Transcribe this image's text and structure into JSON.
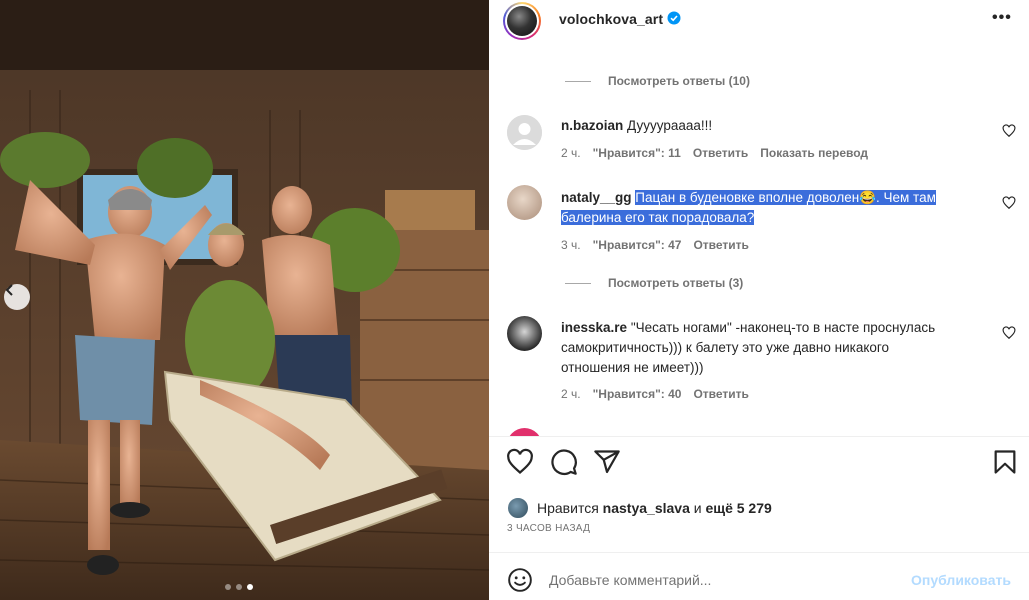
{
  "post": {
    "username": "volochkova_art",
    "carousel_dots": 3,
    "carousel_active": 3
  },
  "comments": {
    "replies_1": "Посмотреть ответы (10)",
    "c1": {
      "user": "n.bazoian",
      "text": "Дуууураааа!!!",
      "time": "2 ч.",
      "likes": "\"Нравится\": 11",
      "reply": "Ответить",
      "translate": "Показать перевод"
    },
    "c2": {
      "user": "nataly__gg",
      "text_line1": "Пацан в буденовке вполне доволен😂. Чем там",
      "text_line2": "балерина его так порадовала?",
      "time": "3 ч.",
      "likes": "\"Нравится\": 47",
      "reply": "Ответить"
    },
    "replies_2": "Посмотреть ответы (3)",
    "c3": {
      "user": "inesska.re",
      "text_line1": "\"Чесать ногами\" -наконец-то в насте проснулась",
      "text_line2": "самокритичность))) к балету это уже давно никакого",
      "text_line3": "отношения не имеет)))",
      "time": "2 ч.",
      "likes": "\"Нравится\": 40",
      "reply": "Ответить"
    }
  },
  "likes_row": {
    "prefix": "Нравится",
    "user": "nastya_slava",
    "mid": "и",
    "rest": "ещё 5 279"
  },
  "timestamp": "3 ЧАСОВ НАЗАД",
  "composer": {
    "placeholder": "Добавьте комментарий...",
    "publish": "Опубликовать"
  },
  "colors": {
    "accent": "#0095f6",
    "highlight": "#3b6ddb",
    "muted": "#737373",
    "publish_disabled": "#b3dbff"
  },
  "icons": [
    "chevron-left-icon",
    "verified-icon",
    "more-icon",
    "heart-icon",
    "comment-icon",
    "share-icon",
    "bookmark-icon",
    "emoji-icon"
  ]
}
